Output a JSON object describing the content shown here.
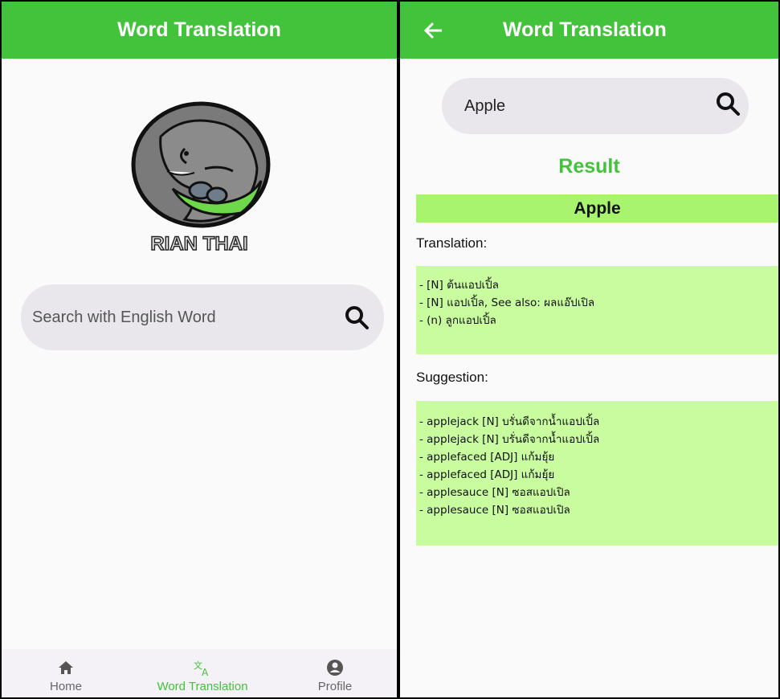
{
  "left_screen": {
    "appbar_title": "Word Translation",
    "brand": "RIAN THAI",
    "search": {
      "placeholder": "Search with English Word"
    },
    "nav": [
      {
        "label": "Home"
      },
      {
        "label": "Word Translation"
      },
      {
        "label": "Profile"
      }
    ]
  },
  "right_screen": {
    "appbar_title": "Word Translation",
    "search": {
      "value": "Apple"
    },
    "result_title": "Result",
    "word": "Apple",
    "translation_label": "Translation:",
    "translations": [
      "- [N] ต้นแอปเปิ้ล",
      "- [N] แอปเปิ้ล, See also: ผลแอ๊ปเปิล",
      "- (n) ลูกแอปเปิ้ล"
    ],
    "suggestion_label": "Suggestion:",
    "suggestions": [
      "- applejack [N] บรั่นดีจากน้ำแอปเปิ้ล",
      "- applejack [N] บรั่นดีจากน้ำแอปเปิ้ล",
      "- applefaced [ADJ] แก้มยุ้ย",
      "- applefaced [ADJ] แก้มยุ้ย",
      "- applesauce [N] ซอสแอปเปิล",
      "- applesauce [N] ซอสแอปเปิล"
    ]
  },
  "colors": {
    "primary": "#43c23b",
    "word_banner": "#a8f46f",
    "result_box": "#c9fb9f",
    "search_bg": "#e9e7ec"
  },
  "icons": [
    "back-arrow-icon",
    "search-icon",
    "home-icon",
    "translate-icon",
    "profile-icon",
    "elephant-logo"
  ]
}
